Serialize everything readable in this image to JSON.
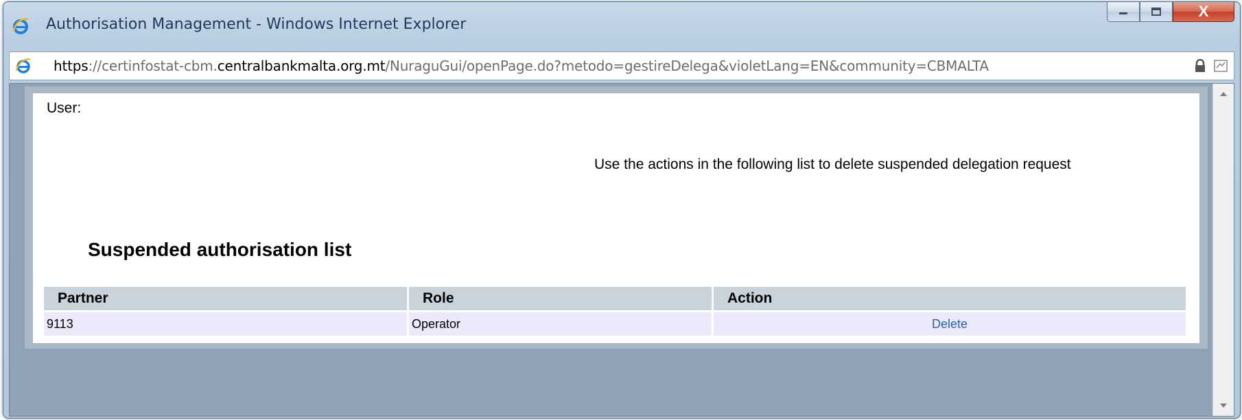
{
  "window": {
    "title": "Authorisation Management - Windows Internet Explorer",
    "close_glyph": "X"
  },
  "address": {
    "scheme": "https",
    "prefix": "://certinfostat-cbm.",
    "domain": "centralbankmalta.org.mt",
    "path": "/NuraguGui/openPage.do?metodo=gestireDelega&violetLang=EN&community=CBMALTA"
  },
  "page": {
    "user_label": "User:",
    "intro": "Use the actions in the following list to delete suspended delegation request",
    "section_title": "Suspended authorisation list"
  },
  "table": {
    "headers": [
      "Partner",
      "Role",
      "Action"
    ],
    "rows": [
      {
        "partner": "9113",
        "role": "Operator",
        "action": "Delete"
      }
    ]
  },
  "icons": {
    "window_icon": "ie-logo-icon",
    "lock": "lock-icon",
    "compat": "compatibility-view-icon"
  }
}
